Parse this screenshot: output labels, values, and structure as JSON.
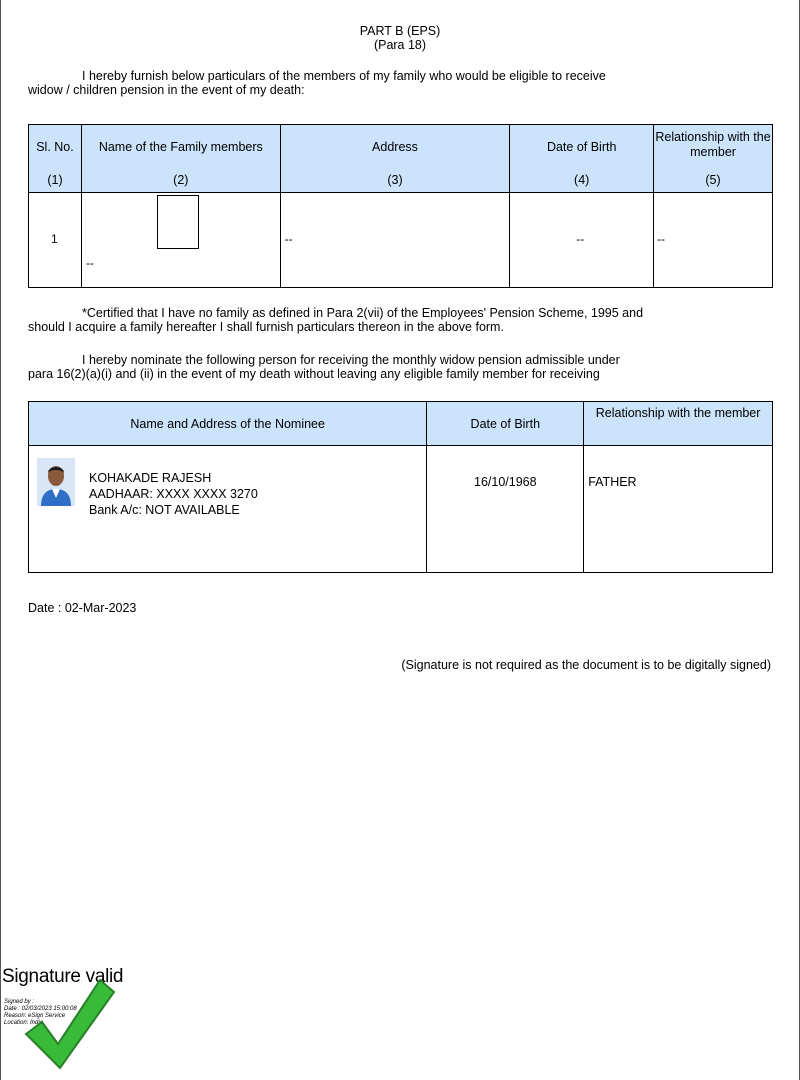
{
  "header": {
    "title_line1": "PART B (EPS)",
    "title_line2": "(Para 18)"
  },
  "intro": {
    "line1": "I hereby furnish below particulars of the members of my family who would be eligible to receive",
    "line2": "widow / children pension in the event of my death:"
  },
  "family_table": {
    "columns": [
      {
        "label": "Sl. No.",
        "num": "(1)"
      },
      {
        "label": "Name of the Family members",
        "num": "(2)"
      },
      {
        "label": "Address",
        "num": "(3)"
      },
      {
        "label": "Date of Birth",
        "num": "(4)"
      },
      {
        "label": "Relationship with the member",
        "num": "(5)"
      }
    ],
    "rows": [
      {
        "sl_no": "1",
        "name": "--",
        "address": "--",
        "dob": "--",
        "relationship": "--"
      }
    ]
  },
  "certification": {
    "line1": "*Certified that I have no family as defined in Para 2(vii) of the Employees' Pension Scheme, 1995 and",
    "line2": "should I acquire a family hereafter I shall furnish particulars thereon in the above form."
  },
  "nomination": {
    "line1": "I hereby nominate the following person for receiving the monthly widow pension admissible under",
    "line2": "para 16(2)(a)(i) and (ii) in the event of my death without leaving any eligible family member for receiving"
  },
  "nominee_table": {
    "columns": [
      "Name and Address of the Nominee",
      "Date of Birth",
      "Relationship with the member"
    ],
    "nominee": {
      "name": "KOHAKADE RAJESH",
      "aadhaar": "AADHAAR: XXXX XXXX 3270",
      "bank": "Bank A/c: NOT AVAILABLE",
      "dob": "16/10/1968",
      "relationship": "FATHER"
    }
  },
  "date_line": "Date : 02-Mar-2023",
  "signature_note": "(Signature is not required as the document is to be digitally signed)",
  "signature_stamp": {
    "status": "Signature valid",
    "signed_by": "Signed by :",
    "date": "Date : 02/03/2023 15:00:08",
    "reason": "Reason: eSign Service",
    "location": "Location: India"
  },
  "colors": {
    "header_fill": "#cce4fb",
    "check_green": "#2eb82e"
  }
}
